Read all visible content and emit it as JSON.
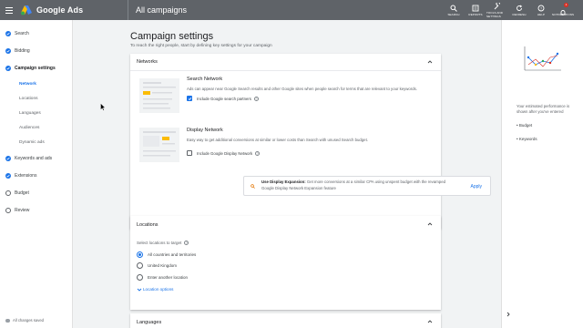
{
  "app": {
    "brand": "Google Ads",
    "page_heading": "All campaigns"
  },
  "toolbar": {
    "items": [
      {
        "label": "SEARCH",
        "icon": "search-icon"
      },
      {
        "label": "REPORTS",
        "icon": "reports-icon"
      },
      {
        "label": "TOOLS AND SETTINGS",
        "icon": "wrench-icon"
      },
      {
        "label": "REFRESH",
        "icon": "refresh-icon"
      },
      {
        "label": "HELP",
        "icon": "help-icon"
      },
      {
        "label": "NOTIFICATIONS",
        "icon": "bell-icon",
        "badge": "1"
      }
    ]
  },
  "sidebar": {
    "steps": [
      {
        "label": "Search",
        "state": "done"
      },
      {
        "label": "Bidding",
        "state": "done"
      },
      {
        "label": "Campaign settings",
        "state": "active"
      }
    ],
    "substeps": [
      {
        "label": "Network",
        "active": true
      },
      {
        "label": "Locations",
        "active": false
      },
      {
        "label": "Languages",
        "active": false
      },
      {
        "label": "Audiences",
        "active": false
      },
      {
        "label": "Dynamic ads",
        "active": false
      }
    ],
    "steps_after": [
      {
        "label": "Keywords and ads",
        "state": "done"
      },
      {
        "label": "Extensions",
        "state": "done"
      },
      {
        "label": "Budget",
        "state": "empty"
      },
      {
        "label": "Review",
        "state": "empty"
      }
    ],
    "saved_text": "All changes saved"
  },
  "main": {
    "title": "Campaign settings",
    "subtitle": "To reach the right people, start by defining key settings for your campaign"
  },
  "networks": {
    "header": "Networks",
    "search_network": {
      "title": "Search Network",
      "description": "Ads can appear near Google Search results and other Google sites when people search for terms that are relevant to your keywords.",
      "checkbox_label": "Include Google search partners",
      "checked": true
    },
    "display_network": {
      "title": "Display Network",
      "description": "Easy way to get additional conversions at similar or lower costs than Search with unused Search budget.",
      "checkbox_label": "Include Google Display Network",
      "checked": false
    },
    "promo": {
      "bold": "Use Display Expansion:",
      "text": " Get more conversions at a similar CPA using unspent budget with the revamped Google Display Network Expansion feature",
      "action": "Apply"
    }
  },
  "locations": {
    "header": "Locations",
    "prompt": "Select locations to target",
    "options": [
      {
        "label": "All countries and territories",
        "selected": true
      },
      {
        "label": "United Kingdom",
        "selected": false
      },
      {
        "label": "Enter another location",
        "selected": false
      }
    ],
    "more_link": "Location options"
  },
  "languages": {
    "header": "Languages"
  },
  "right_panel": {
    "info": "Your estimated performance is shown after you've entered",
    "bullets": [
      "Budget",
      "Keywords"
    ]
  },
  "colors": {
    "topbar": "#5f6368",
    "accent": "#1a73e8",
    "badge": "#d93025",
    "background": "#f1f3f4"
  }
}
